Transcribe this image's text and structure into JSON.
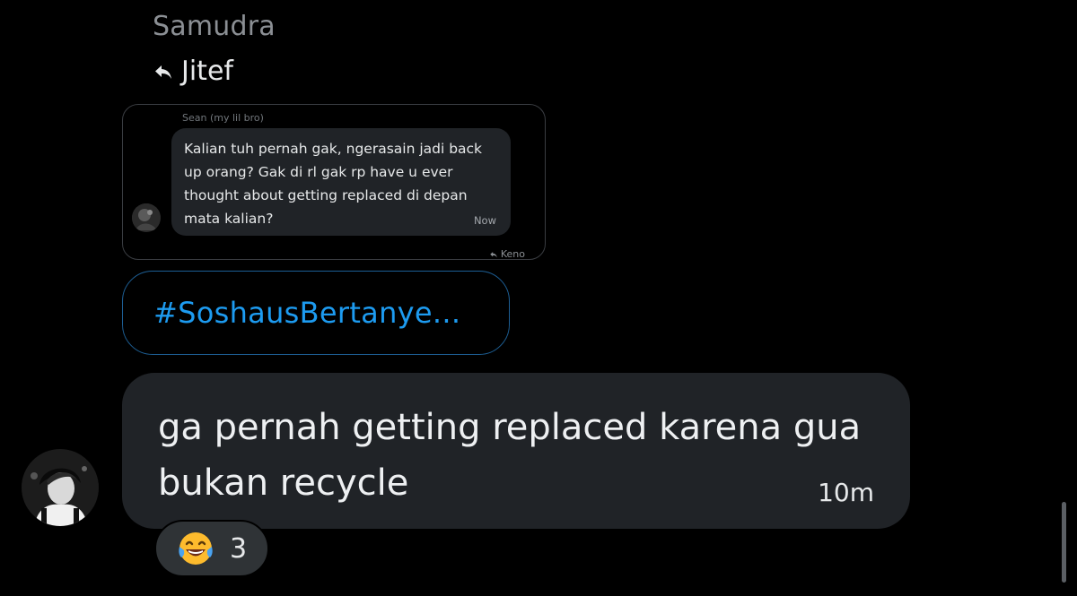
{
  "sender": {
    "name": "Samudra"
  },
  "reply": {
    "icon": "reply-arrow-icon",
    "to_name": "Jitef"
  },
  "quoted_card": {
    "author": "Sean (my lil bro)",
    "text": "Kalian tuh pernah gak, ngerasain jadi back up orang? Gak di rl gak rp have u ever thought about getting replaced di depan mata kalian?",
    "time": "Now",
    "replied_to": "Keno"
  },
  "hashtag": {
    "text": "#SoshausBertanye..."
  },
  "message": {
    "text": "ga pernah getting replaced karena gua bukan recycle",
    "time": "10m"
  },
  "reaction": {
    "emoji": "tears-of-joy-emoji-icon",
    "count": "3"
  },
  "colors": {
    "background": "#000000",
    "bubble": "#202327",
    "accent": "#1d9bf0",
    "muted_text": "#8b8f94"
  }
}
